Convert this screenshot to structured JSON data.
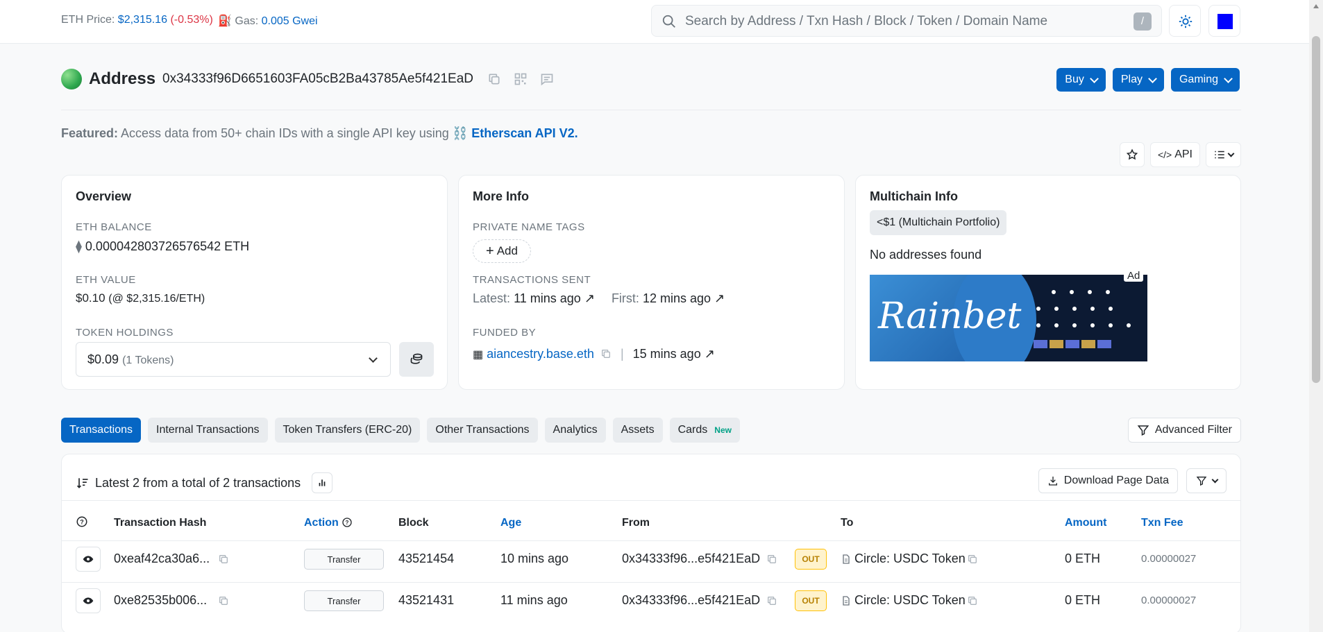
{
  "topbar": {
    "eth_price_label": "ETH Price:",
    "eth_price_value": "$2,315.16",
    "eth_price_change": "(-0.53%)",
    "gas_label": "Gas:",
    "gas_value": "0.005 Gwei",
    "search_placeholder": "Search by Address / Txn Hash / Block / Token / Domain Name",
    "search_shortcut": "/"
  },
  "header": {
    "label": "Address",
    "address": "0x34333f96D6651603FA05cB2Ba43785Ae5f421EaD",
    "buttons": [
      "Buy",
      "Play",
      "Gaming"
    ]
  },
  "featured": {
    "prefix": "Featured:",
    "text": "Access data from 50+ chain IDs with a single API key using",
    "emoji": "⛓️",
    "link": "Etherscan API V2."
  },
  "tools": {
    "api_label": "API"
  },
  "overview": {
    "title": "Overview",
    "eth_balance_label": "ETH BALANCE",
    "eth_balance_value": "0.000042803726576542 ETH",
    "eth_value_label": "ETH VALUE",
    "eth_value_main": "$0.10",
    "eth_value_sub": "(@ $2,315.16/ETH)",
    "token_holdings_label": "TOKEN HOLDINGS",
    "token_value": "$0.09",
    "token_count": "(1 Tokens)"
  },
  "more_info": {
    "title": "More Info",
    "private_tags_label": "PRIVATE NAME TAGS",
    "add_label": "Add",
    "tx_sent_label": "TRANSACTIONS SENT",
    "latest_label": "Latest:",
    "latest_value": "11 mins ago",
    "first_label": "First:",
    "first_value": "12 mins ago",
    "funded_by_label": "FUNDED BY",
    "funded_by_value": "aiancestry.base.eth",
    "funded_time": "15 mins ago"
  },
  "multichain": {
    "title": "Multichain Info",
    "badge_value": "<$1",
    "badge_text": "(Multichain Portfolio)",
    "no_addresses": "No addresses found",
    "ad_brand": "Rainbet",
    "ad_tag": "Ad"
  },
  "tabs": [
    {
      "label": "Transactions",
      "active": true
    },
    {
      "label": "Internal Transactions"
    },
    {
      "label": "Token Transfers (ERC-20)"
    },
    {
      "label": "Other Transactions"
    },
    {
      "label": "Analytics"
    },
    {
      "label": "Assets"
    },
    {
      "label": "Cards",
      "badge": "New"
    }
  ],
  "advanced_filter": "Advanced Filter",
  "table": {
    "summary": "Latest 2 from a total of 2 transactions",
    "download": "Download Page Data",
    "headers": {
      "hash": "Transaction Hash",
      "action": "Action",
      "block": "Block",
      "age": "Age",
      "from": "From",
      "to": "To",
      "amount": "Amount",
      "fee": "Txn Fee"
    },
    "rows": [
      {
        "hash": "0xeaf42ca30a6...",
        "action": "Transfer",
        "block": "43521454",
        "age": "10 mins ago",
        "from": "0x34333f96...e5f421EaD",
        "direction": "OUT",
        "to": "Circle: USDC Token",
        "amount": "0 ETH",
        "fee": "0.00000027"
      },
      {
        "hash": "0xe82535b006...",
        "action": "Transfer",
        "block": "43521431",
        "age": "11 mins ago",
        "from": "0x34333f96...e5f421EaD",
        "direction": "OUT",
        "to": "Circle: USDC Token",
        "amount": "0 ETH",
        "fee": "0.00000027"
      }
    ]
  },
  "colors": {
    "primary": "#0666c4",
    "negative": "#dc3545",
    "out_badge": "#ffc107",
    "new_badge": "#00a186"
  }
}
